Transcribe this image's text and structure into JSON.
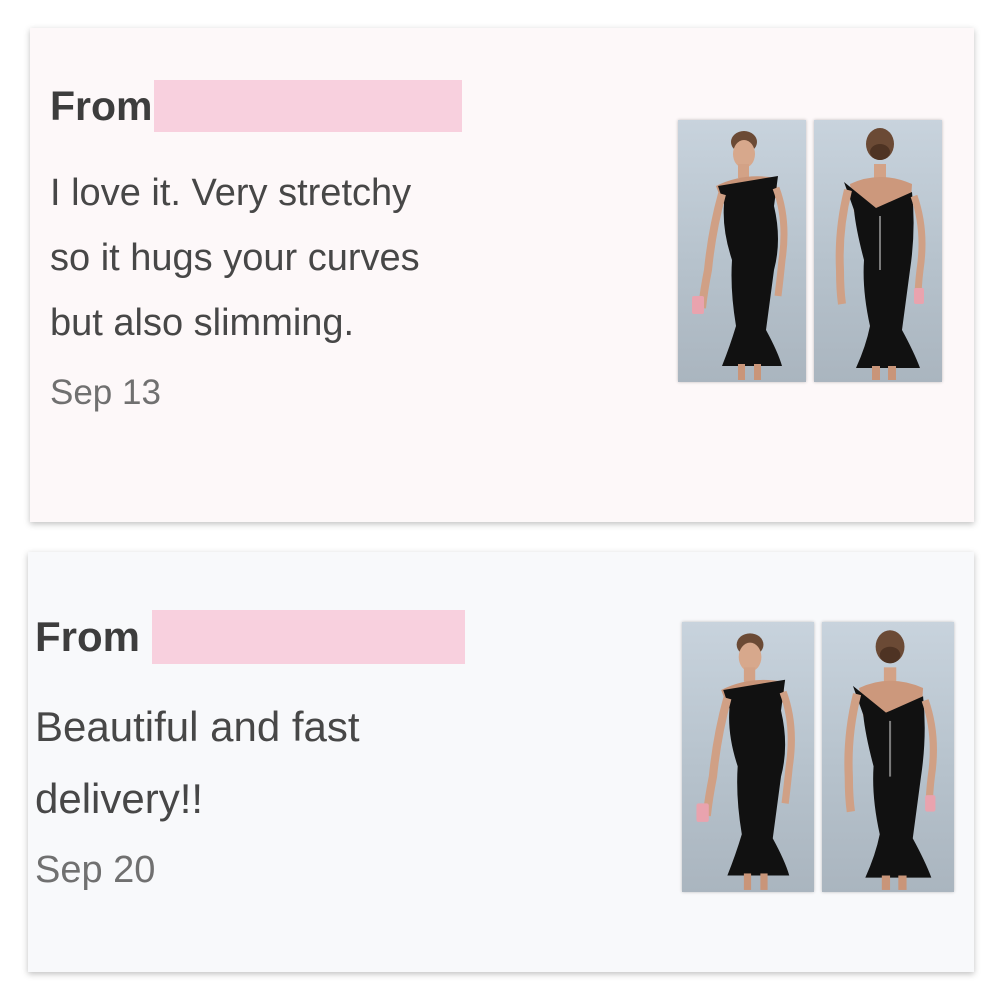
{
  "reviews": [
    {
      "from_label": "From",
      "text": "I love it. Very stretchy\nso it hugs your curves\nbut also slimming.",
      "date": "Sep 13",
      "redaction_color": "#f8d0de",
      "photos": [
        "dress-front-photo",
        "dress-back-photo"
      ]
    },
    {
      "from_label": "From",
      "text": "Beautiful and fast\ndelivery!!",
      "date": "Sep 20",
      "redaction_color": "#f8d0de",
      "photos": [
        "dress-front-photo",
        "dress-back-photo"
      ]
    }
  ]
}
